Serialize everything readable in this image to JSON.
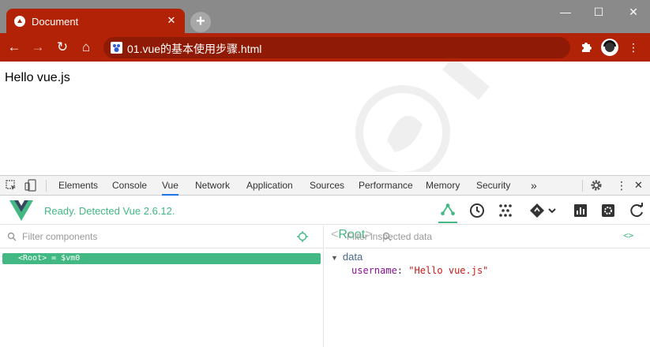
{
  "browser": {
    "tab_title": "Document",
    "tab_close": "✕",
    "new_tab": "+",
    "window_controls": {
      "minimize": "—",
      "maximize": "☐",
      "close": "✕"
    },
    "nav": {
      "back": "←",
      "forward": "→",
      "reload": "↻",
      "home": "⌂"
    },
    "url": "01.vue的基本使用步骤.html",
    "extensions_icon": "puzzle-icon",
    "menu": "⋮",
    "accent_color": "#b22207"
  },
  "page": {
    "text": "Hello vue.js"
  },
  "devtools": {
    "tabs": [
      "Elements",
      "Console",
      "Vue",
      "Network",
      "Application",
      "Sources",
      "Performance",
      "Memory",
      "Security"
    ],
    "active_tab": "Vue",
    "more_tabs": "»",
    "menu": "⋮",
    "close": "✕"
  },
  "vue": {
    "status": "Ready. Detected Vue 2.6.12.",
    "accent_color": "#42b983",
    "components": {
      "filter_placeholder": "Filter components",
      "root_row": "<Root> = $vm0"
    },
    "inspector": {
      "title": "Root",
      "title_open": "<",
      "title_close": ">",
      "filter_placeholder": "Filter inspected data",
      "code_toggle": "<>",
      "section": "data",
      "section_arrow": "▼",
      "fields": [
        {
          "key": "username",
          "colon": ":",
          "value": "\"Hello vue.js\""
        }
      ]
    }
  }
}
